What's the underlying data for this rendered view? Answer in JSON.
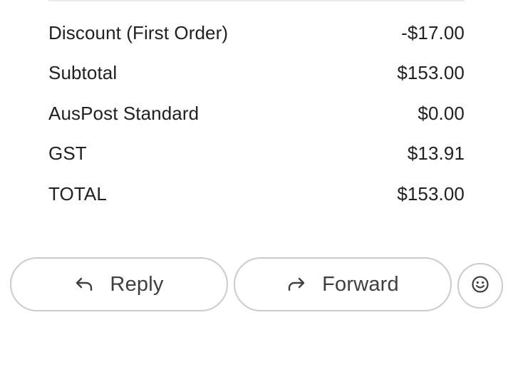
{
  "summary": {
    "rows": [
      {
        "label": "Discount (First Order)",
        "amount": "-$17.00"
      },
      {
        "label": "Subtotal",
        "amount": "$153.00"
      },
      {
        "label": "AusPost Standard",
        "amount": "$0.00"
      },
      {
        "label": "GST",
        "amount": "$13.91"
      },
      {
        "label": "TOTAL",
        "amount": "$153.00"
      }
    ]
  },
  "actions": {
    "reply_label": "Reply",
    "reply_icon": "reply-arrow-icon",
    "forward_label": "Forward",
    "forward_icon": "forward-arrow-icon",
    "emoji_icon": "smiley-face-icon"
  },
  "colors": {
    "text": "#202124",
    "button_text": "#3c4043",
    "border": "#c9cbcf"
  }
}
